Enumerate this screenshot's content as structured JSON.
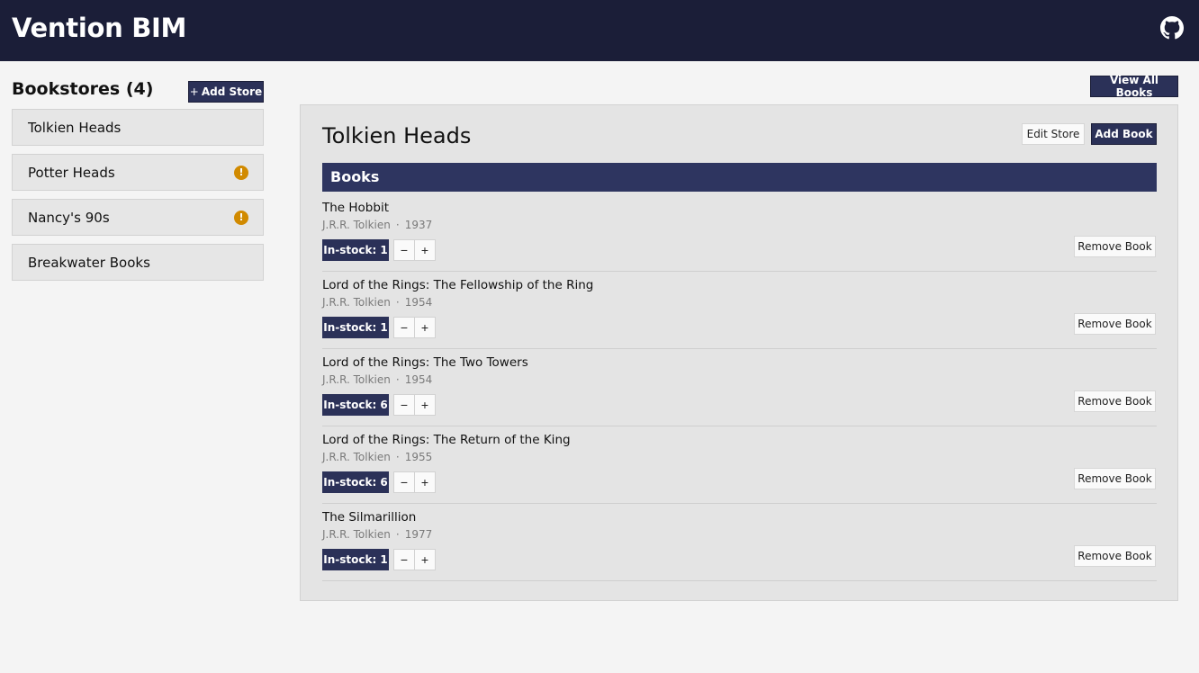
{
  "app": {
    "title": "Vention BIM"
  },
  "sidebar": {
    "title": "Bookstores (4)",
    "add_store_label": "Add Store",
    "add_store_plus": "+",
    "stores": [
      {
        "name": "Tolkien Heads",
        "warning": false
      },
      {
        "name": "Potter Heads",
        "warning": true
      },
      {
        "name": "Nancy's 90s",
        "warning": true
      },
      {
        "name": "Breakwater Books",
        "warning": false
      }
    ],
    "warning_glyph": "!"
  },
  "header": {
    "view_all_books_label": "View All Books"
  },
  "store_panel": {
    "title": "Tolkien Heads",
    "edit_store_label": "Edit Store",
    "add_book_label": "Add Book",
    "books_header": "Books",
    "books": [
      {
        "title": "The Hobbit",
        "author": "J.R.R. Tolkien",
        "year": "1937",
        "stock": "In-stock: 1"
      },
      {
        "title": "Lord of the Rings: The Fellowship of the Ring",
        "author": "J.R.R. Tolkien",
        "year": "1954",
        "stock": "In-stock: 1"
      },
      {
        "title": "Lord of the Rings: The Two Towers",
        "author": "J.R.R. Tolkien",
        "year": "1954",
        "stock": "In-stock: 6"
      },
      {
        "title": "Lord of the Rings: The Return of the King",
        "author": "J.R.R. Tolkien",
        "year": "1955",
        "stock": "In-stock: 6"
      },
      {
        "title": "The Silmarillion",
        "author": "J.R.R. Tolkien",
        "year": "1977",
        "stock": "In-stock: 1"
      }
    ],
    "meta_separator": "·",
    "minus_glyph": "−",
    "plus_glyph": "+",
    "remove_book_label": "Remove Book"
  },
  "colors": {
    "topbar": "#1b1e38",
    "accent": "#2b3158",
    "books_bar": "#2e3560",
    "warning": "#d18a00"
  },
  "icons": {
    "github": "github-icon",
    "warning": "warning-icon"
  }
}
